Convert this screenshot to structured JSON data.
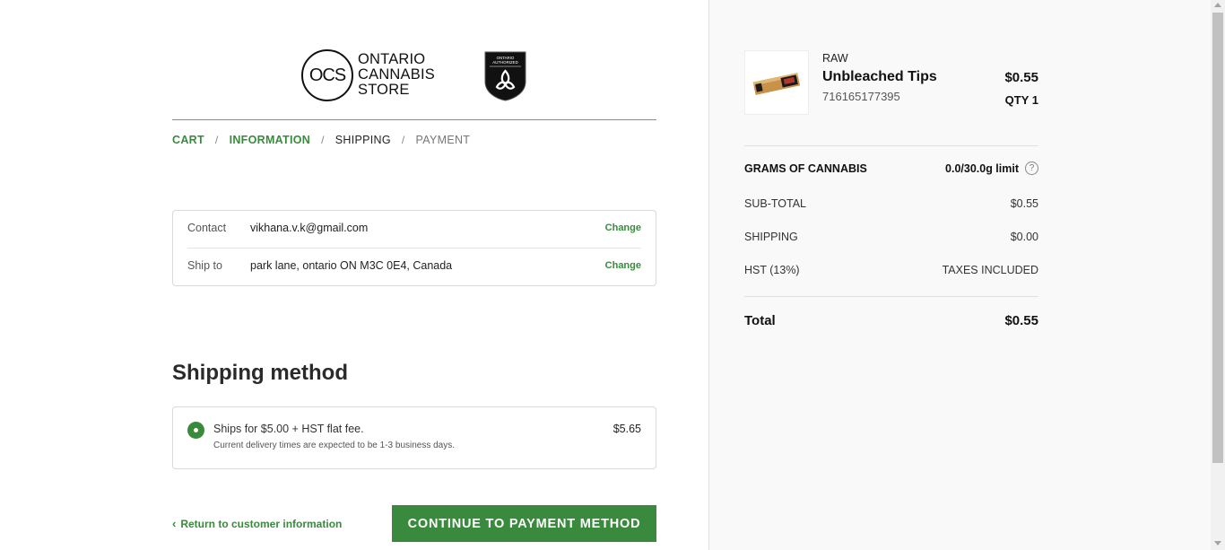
{
  "logo": {
    "ocs_letters": "OCS",
    "line1": "ONTARIO",
    "line2": "CANNABIS",
    "line3": "STORE",
    "badge_line1": "ONTARIO",
    "badge_line2": "AUTHORIZED"
  },
  "breadcrumb": [
    {
      "label": "CART",
      "state": "done"
    },
    {
      "label": "INFORMATION",
      "state": "done"
    },
    {
      "label": "SHIPPING",
      "state": "current"
    },
    {
      "label": "PAYMENT",
      "state": "future"
    }
  ],
  "breadcrumb_separator": "/",
  "review": {
    "contact_label": "Contact",
    "contact_value": "vikhana.v.k@gmail.com",
    "contact_change": "Change",
    "ship_label": "Ship to",
    "ship_value": "park lane, ontario ON M3C 0E4, Canada",
    "ship_change": "Change"
  },
  "shipping_method": {
    "title": "Shipping method",
    "option_name": "Ships for $5.00 + HST flat fee.",
    "option_note": "Current delivery times are expected to be 1-3 business days.",
    "option_price": "$5.65",
    "selected": true
  },
  "actions": {
    "return_label": "Return to customer information",
    "continue_label": "CONTINUE TO PAYMENT METHOD"
  },
  "cart": {
    "item": {
      "brand": "RAW",
      "name": "Unbleached Tips",
      "sku": "716165177395",
      "price": "$0.55",
      "qty": "QTY 1"
    },
    "grams_label": "GRAMS OF CANNABIS",
    "grams_value": "0.0/30.0g limit",
    "help_glyph": "?",
    "subtotal_label": "SUB-TOTAL",
    "subtotal_value": "$0.55",
    "shipping_label": "SHIPPING",
    "shipping_value": "$0.00",
    "tax_label": "HST (13%)",
    "tax_value": "TAXES INCLUDED",
    "total_label": "Total",
    "total_value": "$0.55"
  },
  "colors": {
    "accent": "#3a8a3e",
    "sidebar_bg": "#f9f9f9"
  }
}
